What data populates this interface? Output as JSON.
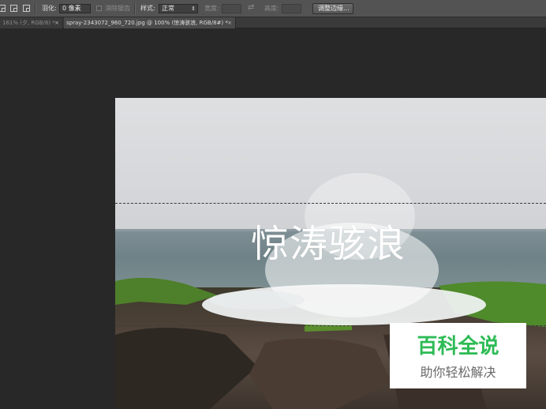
{
  "options_bar": {
    "feather_label": "羽化:",
    "feather_value": "0 像素",
    "antialias_label": "消除锯齿",
    "style_label": "样式:",
    "style_value": "正常",
    "width_label": "宽度:",
    "height_label": "高度:",
    "refine_edge_button": "调整边缘..."
  },
  "tabs": [
    {
      "label": "161% (夕, RGB/8) *",
      "close": "×"
    },
    {
      "label": "spray-2343072_960_720.jpg @ 100% (惊涛骇浪, RGB/8#) *",
      "close": "×"
    }
  ],
  "document": {
    "text_layer": "惊涛骇浪"
  },
  "watermark": {
    "title": "百科全说",
    "subtitle": "助你轻松解决",
    "title_color": "#2dbb55"
  }
}
